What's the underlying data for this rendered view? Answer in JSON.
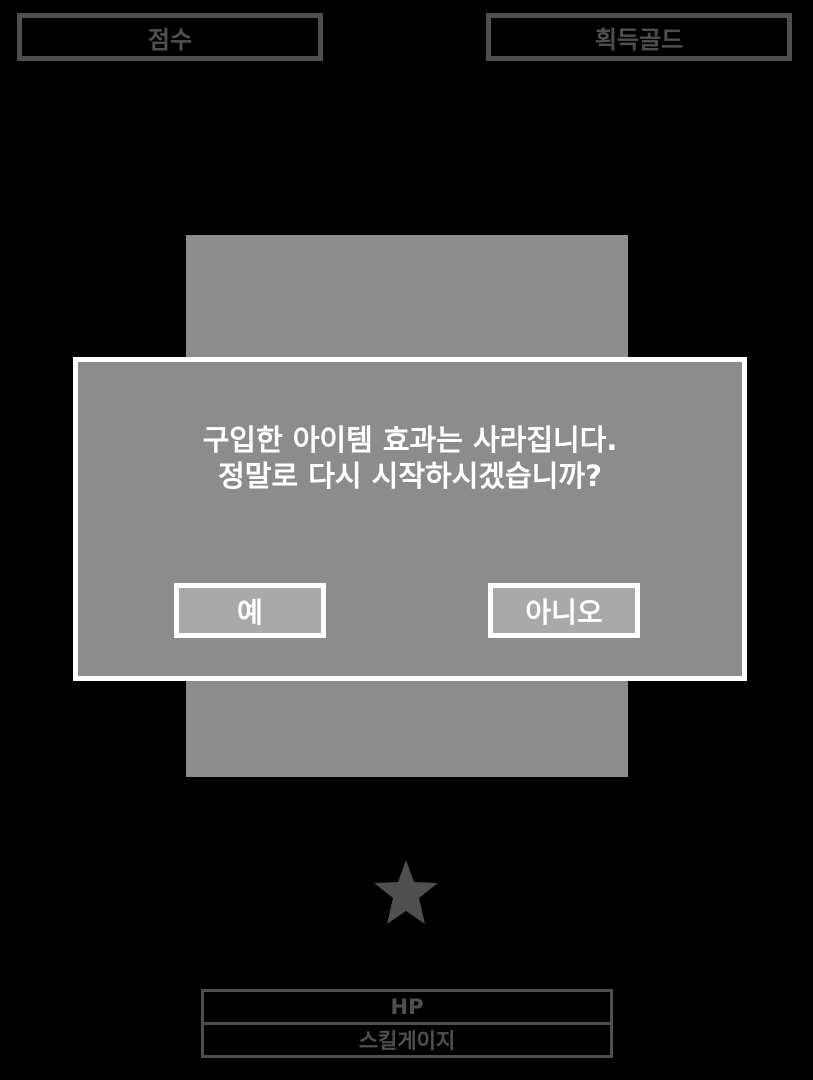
{
  "hud": {
    "score_label": "점수",
    "gold_label": "획득골드"
  },
  "dialog": {
    "line1": "구입한 아이템 효과는 사라집니다.",
    "line2": "정말로 다시 시작하시겠습니까?",
    "yes_label": "예",
    "no_label": "아니오"
  },
  "player": {
    "icon": "star-icon"
  },
  "bars": {
    "hp_label": "HP",
    "skill_label": "스킬게이지"
  },
  "colors": {
    "background": "#000000",
    "hud_gray": "#4f4f4f",
    "panel": "#8c8c8c",
    "button": "#a9a9a9",
    "border": "#ffffff"
  }
}
